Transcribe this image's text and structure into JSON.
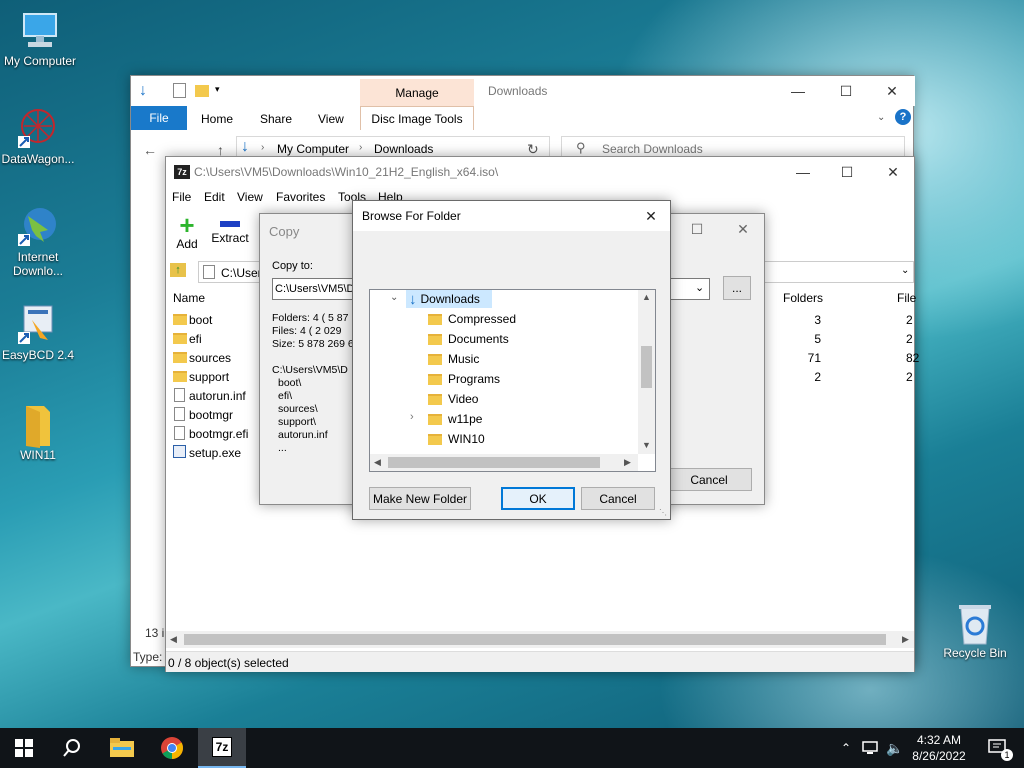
{
  "desktop": {
    "icons": [
      {
        "label": "My Computer",
        "icon": "monitor-icon"
      },
      {
        "label": "DataWagon...",
        "icon": "datawagon-icon"
      },
      {
        "label": "Internet Downlo...",
        "icon": "idm-icon"
      },
      {
        "label": "EasyBCD 2.4",
        "icon": "easybcd-icon"
      },
      {
        "label": "WIN11",
        "icon": "folder-icon"
      },
      {
        "label": "Recycle Bin",
        "icon": "recycle-bin-icon"
      }
    ]
  },
  "explorer": {
    "title": "Downloads",
    "ribbon_context_group": "Manage",
    "tabs": [
      "File",
      "Home",
      "Share",
      "View",
      "Disc Image Tools"
    ],
    "address": [
      "My Computer",
      "Downloads"
    ],
    "search_placeholder": "Search Downloads",
    "status_items": "13 i",
    "type_label": "Type:"
  },
  "sevenzip": {
    "title": "C:\\Users\\VM5\\Downloads\\Win10_21H2_English_x64.iso\\",
    "menu": [
      "File",
      "Edit",
      "View",
      "Favorites",
      "Tools",
      "Help"
    ],
    "toolbar": [
      {
        "label": "Add"
      },
      {
        "label": "Extract"
      }
    ],
    "path": "C:\\User",
    "columns": {
      "name": "Name",
      "folders": "Folders",
      "files": "File"
    },
    "rows": [
      {
        "name": "boot",
        "type": "folder",
        "folders": "3",
        "files": "2"
      },
      {
        "name": "efi",
        "type": "folder",
        "folders": "5",
        "files": "2"
      },
      {
        "name": "sources",
        "type": "folder",
        "folders": "71",
        "files": "82"
      },
      {
        "name": "support",
        "type": "folder",
        "folders": "2",
        "files": "2"
      },
      {
        "name": "autorun.inf",
        "type": "file",
        "folders": "",
        "files": ""
      },
      {
        "name": "bootmgr",
        "type": "file",
        "folders": "",
        "files": ""
      },
      {
        "name": "bootmgr.efi",
        "type": "file",
        "folders": "",
        "files": ""
      },
      {
        "name": "setup.exe",
        "type": "exe",
        "folders": "",
        "files": ""
      }
    ],
    "status": "0 / 8 object(s) selected"
  },
  "copy_dialog": {
    "title": "Copy",
    "copy_to_label": "Copy to:",
    "copy_to_value": "C:\\Users\\VM5\\D",
    "browse_label": "...",
    "info": [
      "Folders: 4    ( 5 87",
      "Files: 4    ( 2 029",
      "Size: 5 878 269 6"
    ],
    "list_path": "C:\\Users\\VM5\\D",
    "list": [
      "boot\\",
      "efi\\",
      "sources\\",
      "support\\",
      "autorun.inf",
      "..."
    ],
    "cancel_label": "Cancel"
  },
  "browse_dialog": {
    "title": "Browse For Folder",
    "tree_root": "Downloads",
    "tree_items": [
      {
        "label": "Compressed",
        "expandable": false
      },
      {
        "label": "Documents",
        "expandable": false
      },
      {
        "label": "Music",
        "expandable": false
      },
      {
        "label": "Programs",
        "expandable": false
      },
      {
        "label": "Video",
        "expandable": false
      },
      {
        "label": "w11pe",
        "expandable": true
      },
      {
        "label": "WIN10",
        "expandable": false
      }
    ],
    "new_folder_label": "Make New Folder",
    "ok_label": "OK",
    "cancel_label": "Cancel"
  },
  "taskbar": {
    "time": "4:32 AM",
    "date": "8/26/2022",
    "notification_count": "1",
    "apps": [
      "file-explorer-icon",
      "chrome-icon",
      "7zip-icon"
    ],
    "sevenzip_glyph": "7z"
  },
  "colors": {
    "accent": "#0078d7",
    "manage_tab": "#fce4d6",
    "selection": "#cce8ff"
  }
}
